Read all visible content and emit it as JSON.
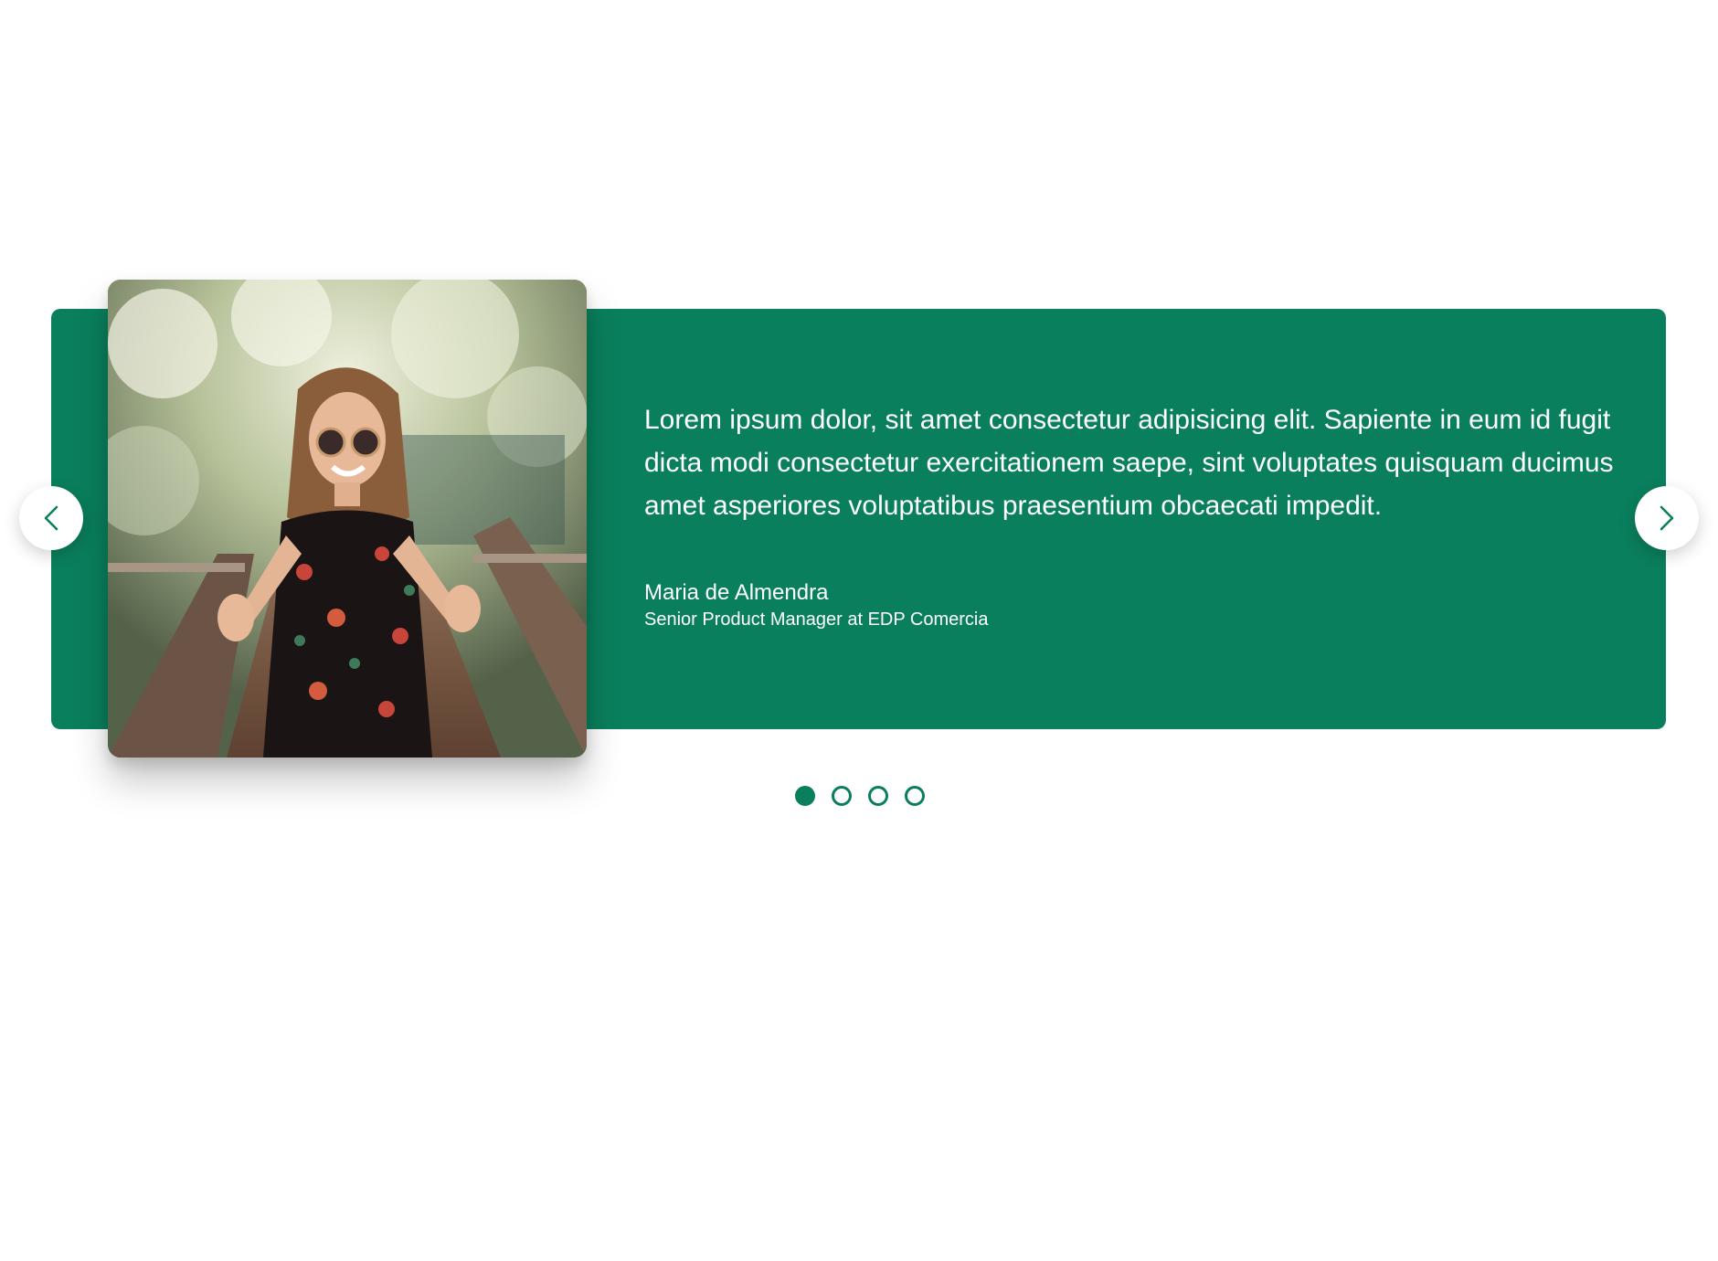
{
  "carousel": {
    "accent_color": "#0a7f5d",
    "active_index": 0,
    "slide_count": 4,
    "testimonial": {
      "quote": "Lorem ipsum dolor, sit amet consectetur adipisicing elit. Sapiente in eum id fugit dicta modi consectetur exercitationem saepe, sint voluptates quisquam ducimus amet asperiores voluptatibus praesentium obcaecati impedit.",
      "author_name": "Maria de Almendra",
      "author_title": "Senior Product Manager at EDP Comercia"
    },
    "prev_icon": "chevron-left-icon",
    "next_icon": "chevron-right-icon"
  }
}
